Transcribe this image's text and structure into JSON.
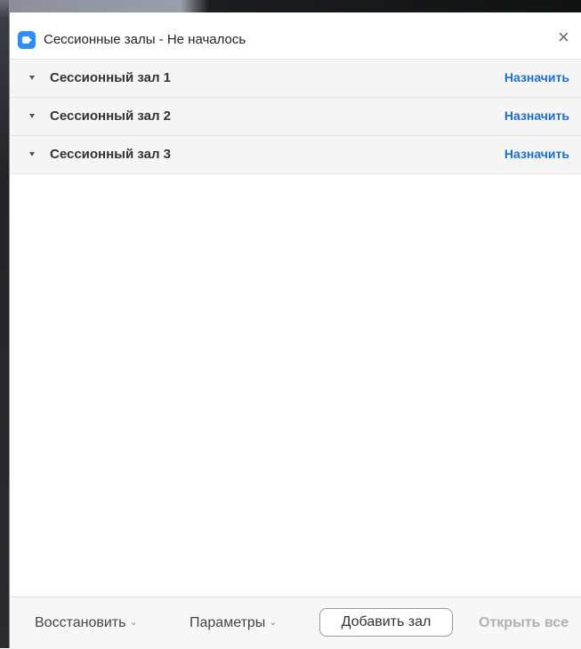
{
  "window": {
    "title": "Сессионные залы - Не началось",
    "close": "×"
  },
  "rooms": [
    {
      "name": "Сессионный зал 1",
      "assign": "Назначить"
    },
    {
      "name": "Сессионный зал 2",
      "assign": "Назначить"
    },
    {
      "name": "Сессионный зал 3",
      "assign": "Назначить"
    }
  ],
  "footer": {
    "restore": "Восстановить",
    "params": "Параметры",
    "add_room": "Добавить зал",
    "open_all": "Открыть все"
  },
  "colors": {
    "accent": "#1a6fd1",
    "app_icon": "#2d8cff"
  }
}
